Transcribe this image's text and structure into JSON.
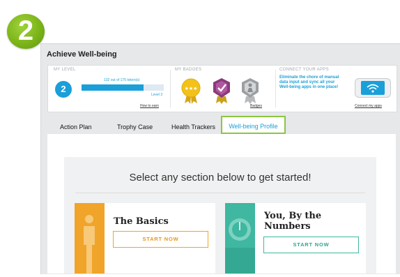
{
  "step_badge": {
    "number": "2"
  },
  "window": {
    "title": "Achieve Well-being"
  },
  "level": {
    "label": "MY LEVEL",
    "number": "2",
    "tokens_text": "132 out of 175 token(s)",
    "progress_fraction": 0.754,
    "next_level": "Level 3",
    "link": "How to earn"
  },
  "badges": {
    "label": "MY BADGES",
    "items": [
      "gold-star-badge",
      "purple-check-badge",
      "gray-person-badge"
    ],
    "link": "Badges"
  },
  "connect": {
    "label": "CONNECT YOUR APPS",
    "text": "Eliminate the chore of manual data input and sync all your Well-being apps in one place!",
    "link": "Connect my apps"
  },
  "tabs": [
    {
      "label": "Action Plan"
    },
    {
      "label": "Trophy Case"
    },
    {
      "label": "Health Trackers"
    },
    {
      "label": "Well-being Profile",
      "active": true
    }
  ],
  "main": {
    "headline": "Select any section below to get started!",
    "cards": [
      {
        "title": "The Basics",
        "button": "START NOW",
        "accent": "#f0a42a"
      },
      {
        "title_line1": "You, By the",
        "title_line2": "Numbers",
        "button": "START NOW",
        "accent": "#3fb7a1"
      }
    ]
  },
  "colors": {
    "accent_blue": "#1a9fd9",
    "accent_green": "#8cc63e"
  }
}
